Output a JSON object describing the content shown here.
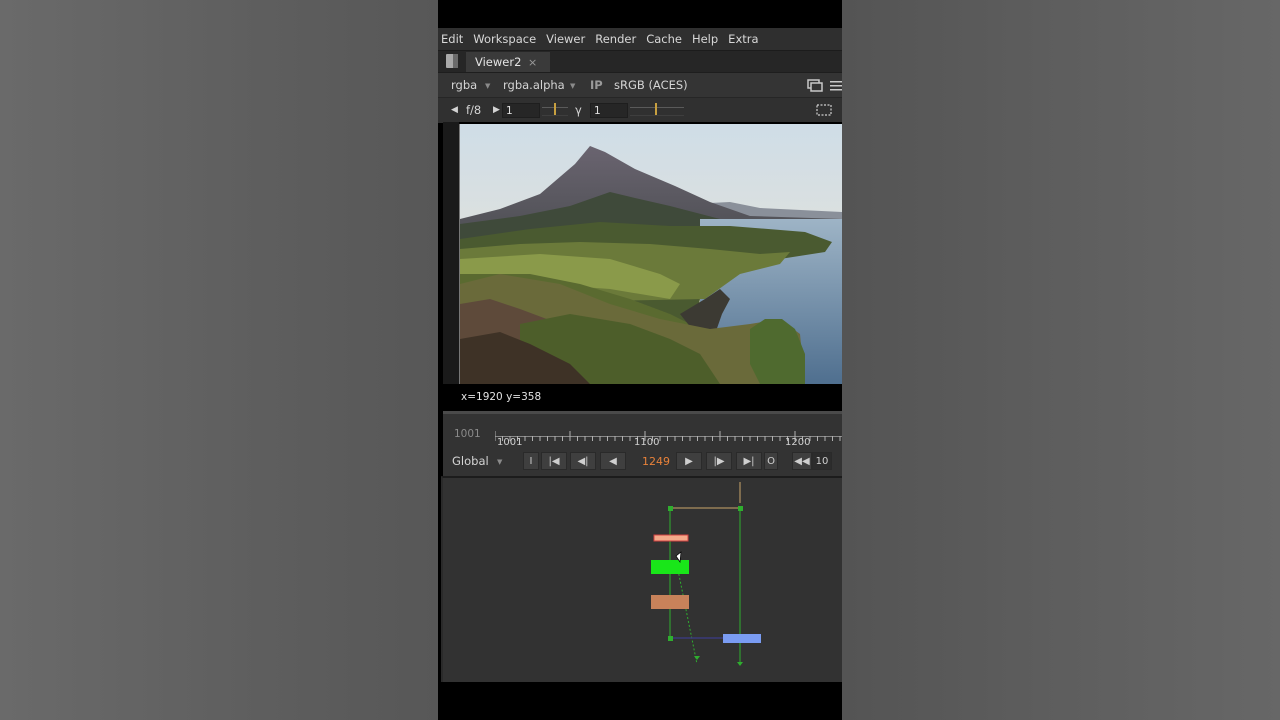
{
  "menu": [
    "Edit",
    "Workspace",
    "Viewer",
    "Render",
    "Cache",
    "Help",
    "Extra"
  ],
  "tab": {
    "title": "Viewer2",
    "close": "×"
  },
  "viewer_toolbar": {
    "channels": "rgba",
    "alpha_channel": "rgba.alpha",
    "ip_label": "IP",
    "colorspace": "sRGB (ACES)"
  },
  "gain_bar": {
    "fstop_label": "f/8",
    "gain_value": "1",
    "gamma_label": "γ",
    "gamma_value": "1"
  },
  "viewer": {
    "coords": "x=1920 y=358"
  },
  "timeline": {
    "start_frame": "1001",
    "ruler_labels": [
      "1001",
      "1100",
      "1200"
    ],
    "range_mode": "Global",
    "current_frame": "1249",
    "increment": "10",
    "in_label": "I",
    "out_label": "O"
  },
  "colors": {
    "frame_accent": "#e8823a",
    "node_read": "#f4a98a",
    "node_grade": "#19e619",
    "node_transform": "#c8825a",
    "node_merge": "#7a9cf2",
    "pipe_green": "#2fae2f",
    "pipe_tan": "#c9a56a"
  }
}
